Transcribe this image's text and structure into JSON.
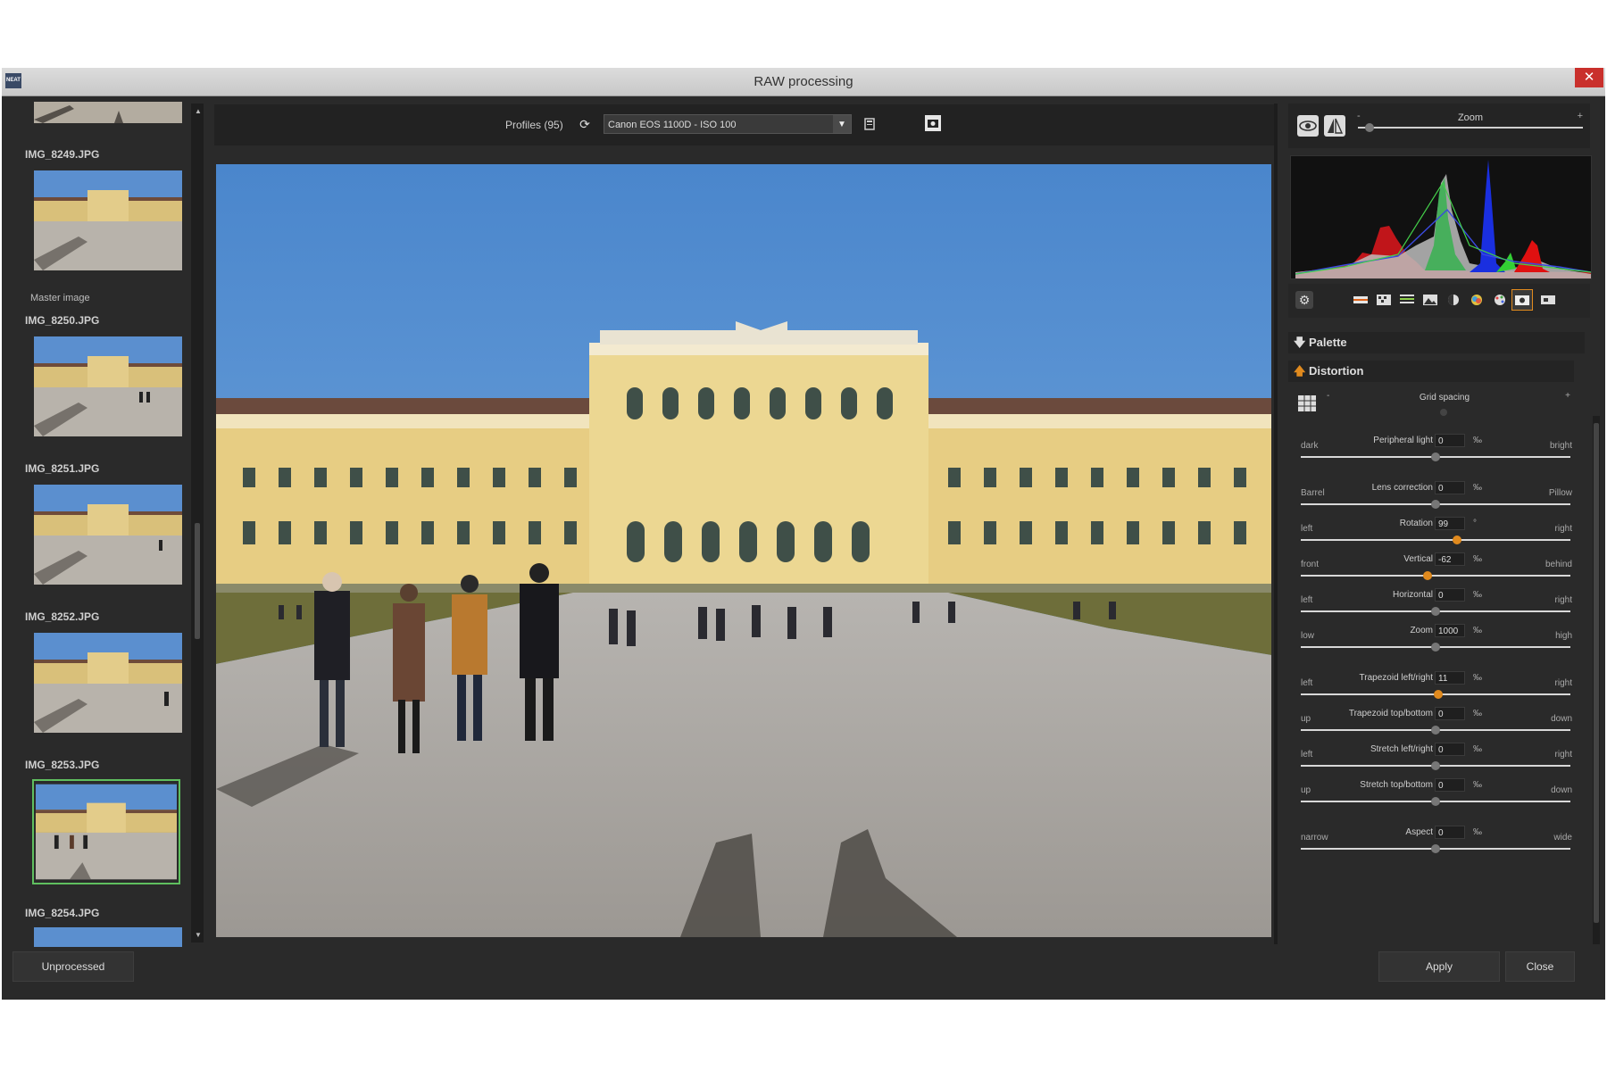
{
  "window": {
    "title": "RAW processing",
    "app_icon": "NEAT",
    "close_glyph": "✕"
  },
  "filmstrip": {
    "items": [
      {
        "name": "IMG_8249.JPG",
        "sub": "Master image"
      },
      {
        "name": "IMG_8250.JPG"
      },
      {
        "name": "IMG_8251.JPG"
      },
      {
        "name": "IMG_8252.JPG"
      },
      {
        "name": "IMG_8253.JPG",
        "selected": true
      },
      {
        "name": "IMG_8254.JPG"
      }
    ]
  },
  "toolbar": {
    "profiles_label": "Profiles (95)",
    "profile_selected": "Canon EOS 1100D - ISO 100",
    "icons": [
      "refresh-icon",
      "save-icon",
      "camera-icon"
    ]
  },
  "right_panel": {
    "zoom_label": "Zoom",
    "zoom_minus": "-",
    "zoom_plus": "+",
    "palette_label": "Palette",
    "distortion_label": "Distortion",
    "grid_spacing_label": "Grid spacing",
    "grid_minus": "-",
    "grid_plus": "+",
    "sliders": [
      {
        "left": "dark",
        "name": "Peripheral light",
        "value": "0",
        "unit": "‰",
        "right": "bright",
        "pos": 0.5,
        "active": false
      },
      {
        "left": "Barrel",
        "name": "Lens correction",
        "value": "0",
        "unit": "‰",
        "right": "Pillow",
        "pos": 0.5,
        "active": false
      },
      {
        "left": "left",
        "name": "Rotation",
        "value": "99",
        "unit": "°",
        "right": "right",
        "pos": 0.58,
        "active": true
      },
      {
        "left": "front",
        "name": "Vertical",
        "value": "-62",
        "unit": "‰",
        "right": "behind",
        "pos": 0.47,
        "active": true
      },
      {
        "left": "left",
        "name": "Horizontal",
        "value": "0",
        "unit": "‰",
        "right": "right",
        "pos": 0.5,
        "active": false
      },
      {
        "left": "low",
        "name": "Zoom",
        "value": "1000",
        "unit": "‰",
        "right": "high",
        "pos": 0.5,
        "active": false
      },
      {
        "left": "left",
        "name": "Trapezoid left/right",
        "value": "11",
        "unit": "‰",
        "right": "right",
        "pos": 0.51,
        "active": true
      },
      {
        "left": "up",
        "name": "Trapezoid top/bottom",
        "value": "0",
        "unit": "‰",
        "right": "down",
        "pos": 0.5,
        "active": false
      },
      {
        "left": "left",
        "name": "Stretch left/right",
        "value": "0",
        "unit": "‰",
        "right": "right",
        "pos": 0.5,
        "active": false
      },
      {
        "left": "up",
        "name": "Stretch top/bottom",
        "value": "0",
        "unit": "‰",
        "right": "down",
        "pos": 0.5,
        "active": false
      },
      {
        "left": "narrow",
        "name": "Aspect",
        "value": "0",
        "unit": "‰",
        "right": "wide",
        "pos": 0.5,
        "active": false
      }
    ]
  },
  "footer": {
    "unprocessed": "Unprocessed",
    "apply": "Apply",
    "close": "Close"
  },
  "colors": {
    "active_knob": "#e08a1e",
    "selected_border": "#5fbf5f",
    "close_red": "#c9302c"
  }
}
